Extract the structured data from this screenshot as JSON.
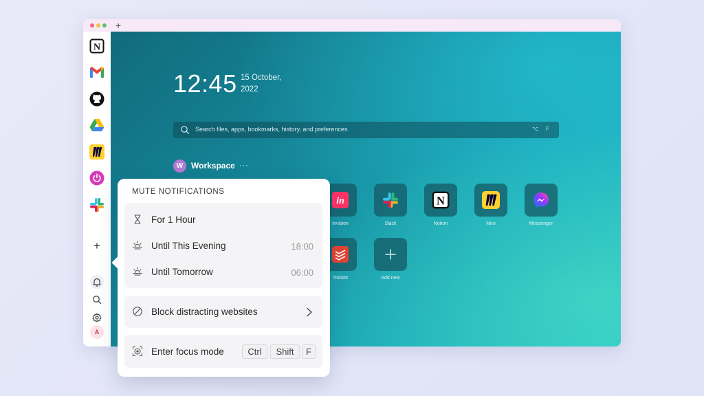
{
  "titlebar": {
    "new_tab_label": "+"
  },
  "sidebar": {
    "apps": [
      {
        "name": "Notion",
        "icon": "notion-icon"
      },
      {
        "name": "Gmail",
        "icon": "gmail-icon"
      },
      {
        "name": "GitHub",
        "icon": "github-icon"
      },
      {
        "name": "Google Drive",
        "icon": "google-drive-icon"
      },
      {
        "name": "Miro",
        "icon": "miro-icon"
      },
      {
        "name": "Power",
        "icon": "power-icon"
      },
      {
        "name": "Slack",
        "icon": "slack-icon"
      }
    ],
    "add_label": "+",
    "avatar_initial": "A"
  },
  "main": {
    "time": "12:45",
    "date_line1": "15 October,",
    "date_line2": "2022",
    "search": {
      "placeholder": "Search files, apps, bookmarks, history, and preferences",
      "shortcut_modifier": "⌥",
      "shortcut_key": "F"
    },
    "workspace": {
      "initial": "W",
      "name": "Workspace",
      "more": "···"
    },
    "tiles_row1": [
      {
        "label": "",
        "icon": "teams-icon"
      },
      {
        "label": "",
        "icon": "asana-icon"
      },
      {
        "label": "",
        "icon": "gmail-icon"
      },
      {
        "label": "Invision",
        "icon": "invision-icon"
      },
      {
        "label": "Slack",
        "icon": "slack-icon"
      },
      {
        "label": "Notion",
        "icon": "notion-icon"
      },
      {
        "label": "Miro",
        "icon": "miro-icon"
      },
      {
        "label": "Messenger",
        "icon": "messenger-icon"
      }
    ],
    "tiles_row2": [
      {
        "label": "Todoist",
        "icon": "todoist-icon"
      },
      {
        "label": "Add new",
        "icon": "plus-icon"
      }
    ]
  },
  "popover": {
    "title": "MUTE NOTIFICATIONS",
    "mute_options": [
      {
        "label": "For 1 Hour",
        "time": ""
      },
      {
        "label": "Until This Evening",
        "time": "18:00"
      },
      {
        "label": "Until Tomorrow",
        "time": "06:00"
      }
    ],
    "block_label": "Block distracting websites",
    "focus": {
      "label": "Enter focus mode",
      "keys": [
        "Ctrl",
        "Shift",
        "F"
      ]
    }
  },
  "colors": {
    "accent": "#1aa8b8",
    "workspace_avatar": "#b27ad6",
    "titlebar": "#f7e9f7"
  }
}
